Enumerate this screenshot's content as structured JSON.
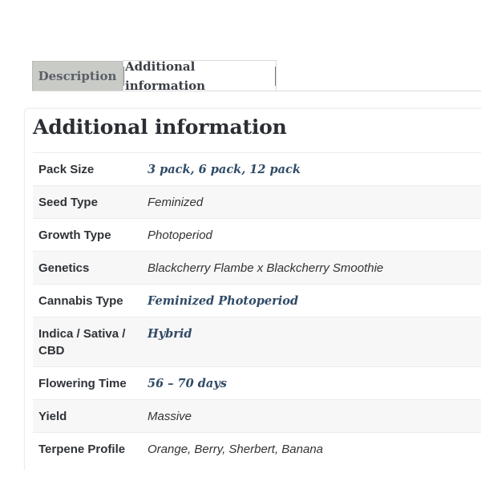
{
  "tabs": [
    {
      "label": "Description"
    },
    {
      "label": "Additional information"
    }
  ],
  "panel": {
    "title": "Additional information"
  },
  "attributes": [
    {
      "label": "Pack Size",
      "value": "3 pack, 6 pack, 12 pack",
      "style": "link"
    },
    {
      "label": "Seed Type",
      "value": "Feminized",
      "style": "plain"
    },
    {
      "label": "Growth Type",
      "value": "Photoperiod",
      "style": "plain"
    },
    {
      "label": "Genetics",
      "value": "Blackcherry Flambe x Blackcherry Smoothie",
      "style": "plain"
    },
    {
      "label": "Cannabis Type",
      "value": "Feminized Photoperiod",
      "style": "link"
    },
    {
      "label": "Indica / Sativa / CBD",
      "value": "Hybrid",
      "style": "link"
    },
    {
      "label": "Flowering Time",
      "value": "56 – 70 days",
      "style": "link"
    },
    {
      "label": "Yield",
      "value": "Massive",
      "style": "plain"
    },
    {
      "label": "Terpene Profile",
      "value": "Orange, Berry, Sherbert, Banana",
      "style": "plain"
    }
  ],
  "colors": {
    "active_tab_bg": "#c9cbc7",
    "link_value": "#2f4a66",
    "row_stripe": "#f7f7f7"
  }
}
